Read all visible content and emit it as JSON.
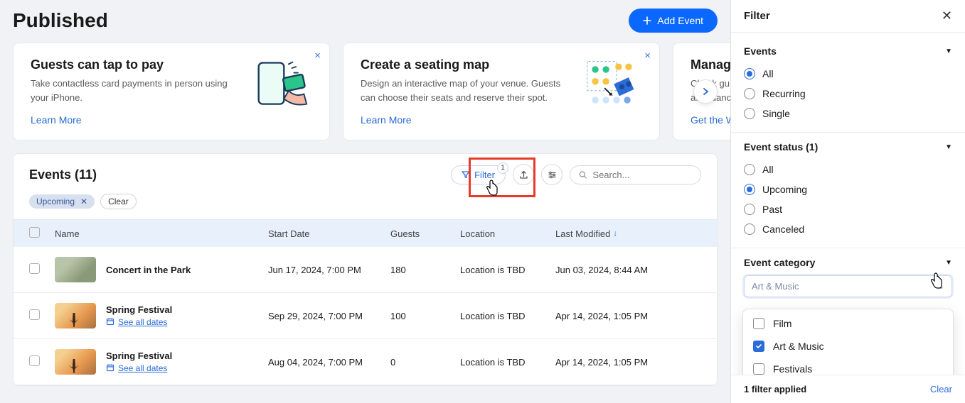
{
  "page": {
    "title": "Published",
    "add_event": "Add Event"
  },
  "cards": [
    {
      "title": "Guests can tap to pay",
      "desc": "Take contactless card payments in person using your iPhone.",
      "link": "Learn More"
    },
    {
      "title": "Create a seating map",
      "desc": "Design an interactive map of your venue. Guests can choose their seats and reserve their spot.",
      "link": "Learn More"
    },
    {
      "title": "Manage",
      "desc": "Check gu\nattendanc",
      "link": "Get the W"
    }
  ],
  "events": {
    "heading": "Events (11)",
    "filter_label": "Filter",
    "filter_badge": "1",
    "search_placeholder": "Search...",
    "chip_upcoming": "Upcoming",
    "chip_clear": "Clear",
    "columns": {
      "name": "Name",
      "start": "Start Date",
      "guests": "Guests",
      "location": "Location",
      "modified": "Last Modified"
    },
    "see_all": "See all dates",
    "rows": [
      {
        "name": "Concert in the Park",
        "start": "Jun 17, 2024, 7:00 PM",
        "guests": "180",
        "location": "Location is TBD",
        "modified": "Jun 03, 2024, 8:44 AM",
        "recurring": false
      },
      {
        "name": "Spring Festival",
        "start": "Sep 29, 2024, 7:00 PM",
        "guests": "100",
        "location": "Location is TBD",
        "modified": "Apr 14, 2024, 1:05 PM",
        "recurring": true
      },
      {
        "name": "Spring Festival",
        "start": "Aug 04, 2024, 7:00 PM",
        "guests": "0",
        "location": "Location is TBD",
        "modified": "Apr 14, 2024, 1:05 PM",
        "recurring": true
      }
    ]
  },
  "filter": {
    "title": "Filter",
    "events_section": {
      "title": "Events",
      "options": [
        "All",
        "Recurring",
        "Single"
      ],
      "selected": "All"
    },
    "status_section": {
      "title": "Event status (1)",
      "options": [
        "All",
        "Upcoming",
        "Past",
        "Canceled"
      ],
      "selected": "Upcoming"
    },
    "category_section": {
      "title": "Event category",
      "placeholder": "Art & Music",
      "options": [
        {
          "label": "Film",
          "checked": false
        },
        {
          "label": "Art & Music",
          "checked": true
        },
        {
          "label": "Festivals",
          "checked": false
        }
      ]
    },
    "footer": {
      "applied": "1 filter applied",
      "clear": "Clear"
    }
  }
}
